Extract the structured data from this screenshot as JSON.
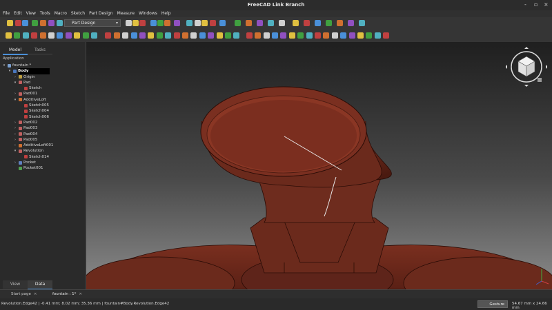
{
  "window": {
    "title": "FreeCAD Link Branch",
    "controls": [
      "-",
      "▫",
      "×"
    ]
  },
  "menu": [
    "File",
    "Edit",
    "View",
    "Tools",
    "Macro",
    "Sketch",
    "Part Design",
    "Measure",
    "Windows",
    "Help"
  ],
  "toolbar": {
    "workbench": "Part Design"
  },
  "combo": {
    "tabs": [
      "Model",
      "Tasks"
    ],
    "section": "Application",
    "tree": [
      {
        "label": "fountain *",
        "depth": 0,
        "arrow": "▾",
        "color": "#7aa0d0"
      },
      {
        "label": "Body",
        "depth": 1,
        "arrow": "▾",
        "color": "#4a78c0",
        "selected": true
      },
      {
        "label": "Origin",
        "depth": 2,
        "arrow": "›",
        "color": "#c0a040"
      },
      {
        "label": "Pad",
        "depth": 2,
        "arrow": "▾",
        "color": "#c06060"
      },
      {
        "label": "Sketch",
        "depth": 3,
        "arrow": "",
        "color": "#c04040"
      },
      {
        "label": "Pad001",
        "depth": 2,
        "arrow": "›",
        "color": "#c06060"
      },
      {
        "label": "AdditiveLoft",
        "depth": 2,
        "arrow": "▾",
        "color": "#d07030"
      },
      {
        "label": "Sketch005",
        "depth": 3,
        "arrow": "",
        "color": "#c04040"
      },
      {
        "label": "Sketch004",
        "depth": 3,
        "arrow": "",
        "color": "#c04040"
      },
      {
        "label": "Sketch006",
        "depth": 3,
        "arrow": "",
        "color": "#c04040"
      },
      {
        "label": "Pad002",
        "depth": 2,
        "arrow": "›",
        "color": "#c06060"
      },
      {
        "label": "Pad003",
        "depth": 2,
        "arrow": "›",
        "color": "#c06060"
      },
      {
        "label": "Pad004",
        "depth": 2,
        "arrow": "›",
        "color": "#c06060"
      },
      {
        "label": "Pad005",
        "depth": 2,
        "arrow": "›",
        "color": "#c06060"
      },
      {
        "label": "AdditiveLoft001",
        "depth": 2,
        "arrow": "›",
        "color": "#d07030"
      },
      {
        "label": "Revolution",
        "depth": 2,
        "arrow": "▾",
        "color": "#c06060"
      },
      {
        "label": "Sketch014",
        "depth": 3,
        "arrow": "",
        "color": "#c04040"
      },
      {
        "label": "Pocket",
        "depth": 2,
        "arrow": "›",
        "color": "#6080c0"
      },
      {
        "label": "Pocket001",
        "depth": 2,
        "arrow": "",
        "color": "#50a050"
      }
    ],
    "bottom_tabs": [
      "View",
      "Data"
    ]
  },
  "doc_tabs": [
    {
      "label": "Start page",
      "active": false
    },
    {
      "label": "fountain : 1*",
      "active": true
    }
  ],
  "status": {
    "message": "Revolution.Edge42 | -0.41 mm; 8.02 mm; 35.36 mm | fountain#Body.Revolution.Edge42",
    "navigation": "Gesture",
    "dimensions": "54.67 mm x 24.66 mm"
  },
  "colors": {
    "model": "#6b2a1c",
    "accent": "#4a90d9"
  }
}
